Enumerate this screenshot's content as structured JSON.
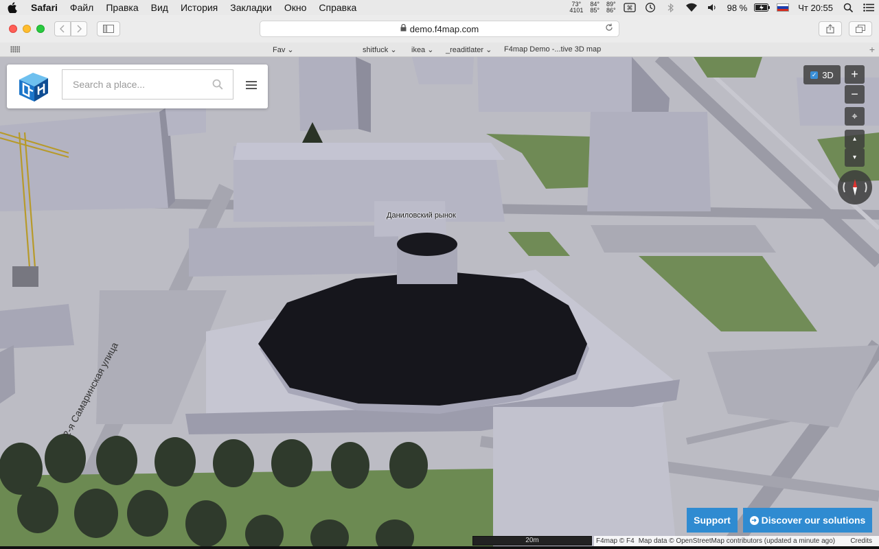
{
  "menubar": {
    "app_name": "Safari",
    "items": [
      "Файл",
      "Правка",
      "Вид",
      "История",
      "Закладки",
      "Окно",
      "Справка"
    ],
    "stats": [
      {
        "top": "73°",
        "bottom": "4101"
      },
      {
        "top": "84°",
        "bottom": "85°"
      },
      {
        "top": "89°",
        "bottom": "86°"
      }
    ],
    "battery": "98 %",
    "clock": "Чт 20:55"
  },
  "toolbar": {
    "url": "demo.f4map.com"
  },
  "bookmarks": {
    "items": [
      "Fav ⌄",
      "shitfuck ⌄",
      "ikea ⌄",
      "_readitlater ⌄",
      "F4map Demo -...tive 3D map"
    ]
  },
  "map": {
    "search_placeholder": "Search a place...",
    "toggle_3d_label": "3D",
    "zoom_in": "+",
    "zoom_out": "−",
    "tilt_up": "▴",
    "tilt_down": "▾",
    "locate": "⌖",
    "place_label": "Даниловский рынок",
    "street_label": "2-я Самаринская улица",
    "support_label": "Support",
    "discover_label": "Discover our solutions",
    "scale_label": "20m",
    "attribution": {
      "f4": "F4map © F4",
      "osm": "Map data © OpenStreetMap contributors (updated a minute ago)",
      "credits": "Credits"
    }
  },
  "colors": {
    "accent_button": "#2f8bd1",
    "dome": "#16161c",
    "building": "#a9a9b8",
    "grass": "#6f8a55"
  }
}
